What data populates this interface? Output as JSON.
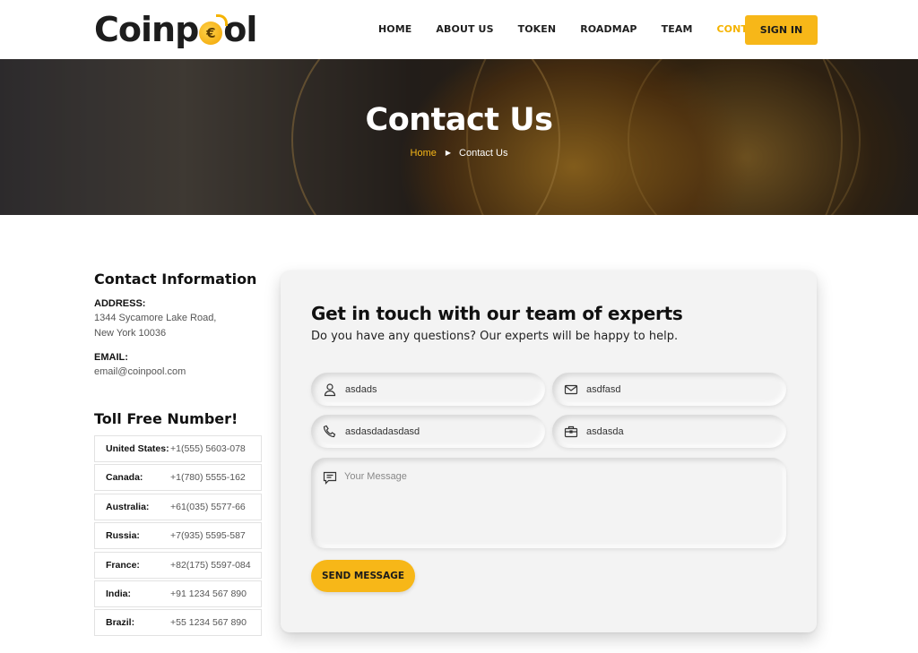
{
  "header": {
    "logo_text_left": "Coinp",
    "logo_coin": "€",
    "logo_text_right": "ol",
    "nav": [
      "HOME",
      "ABOUT US",
      "TOKEN",
      "ROADMAP",
      "TEAM",
      "CONTACT US"
    ],
    "active_nav": "CONTACT US",
    "signin_label": "SIGN IN"
  },
  "hero": {
    "title": "Contact Us",
    "breadcrumb_home": "Home",
    "breadcrumb_sep": "▶",
    "breadcrumb_current": "Contact Us"
  },
  "contact_info": {
    "title": "Contact Information",
    "address_label": "ADDRESS:",
    "address_line1": "1344 Sycamore Lake Road,",
    "address_line2": "New York 10036",
    "email_label": "EMAIL:",
    "email": "email@coinpool.com"
  },
  "toll_free": {
    "title": "Toll Free Number!",
    "rows": [
      {
        "country": "United States:",
        "number": "+1(555) 5603-078"
      },
      {
        "country": "Canada:",
        "number": "+1(780) 5555-162"
      },
      {
        "country": "Australia:",
        "number": "+61(035) 5577-66"
      },
      {
        "country": "Russia:",
        "number": "+7(935) 5595-587"
      },
      {
        "country": "France:",
        "number": "+82(175) 5597-084"
      },
      {
        "country": "India:",
        "number": "+91 1234 567 890"
      },
      {
        "country": "Brazil:",
        "number": "+55 1234 567 890"
      }
    ]
  },
  "form": {
    "title": "Get in touch with our team of experts",
    "subtitle": "Do you have any questions? Our experts will be happy to help.",
    "name_value": "asdads",
    "email_value": "asdfasd",
    "phone_value": "asdasdadasdasd",
    "subject_value": "asdasda",
    "message_placeholder": "Your Message",
    "send_label": "SEND MESSAGE"
  },
  "colors": {
    "accent": "#f7b718",
    "card_bg": "#f3f3f3"
  }
}
